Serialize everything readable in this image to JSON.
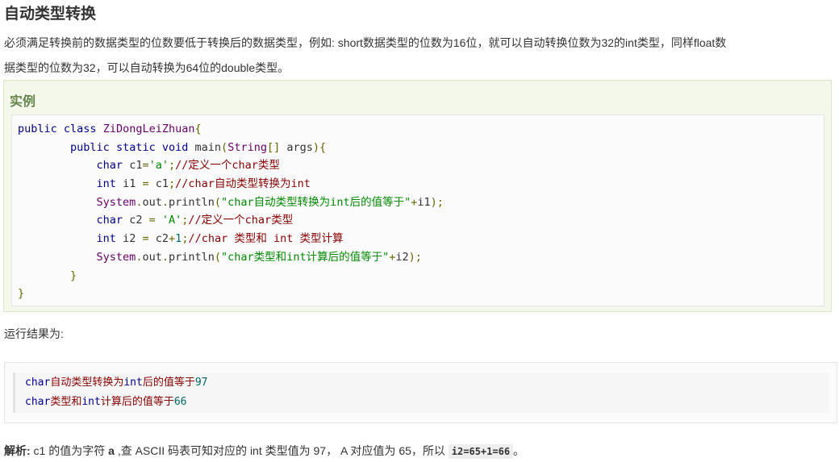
{
  "title": "自动类型转换",
  "paragraph_line1": "必须满足转换前的数据类型的位数要低于转换后的数据类型，例如: short数据类型的位数为16位，就可以自动转换位数为32的int类型，同样float数",
  "paragraph_line2": "据类型的位数为32，可以自动转换为64位的double类型。",
  "example_title": "实例",
  "code": {
    "l1_kw1": "public",
    "l1_kw2": "class",
    "l1_name": "ZiDongLeiZhuan",
    "l1_brace": "{",
    "l2_kw1": "public",
    "l2_kw2": "static",
    "l2_kw3": "void",
    "l2_name": "main",
    "l2_open": "(",
    "l2_type": "String",
    "l2_arr": "[]",
    "l2_arg": "args",
    "l2_close": "){",
    "l3_kw": "char",
    "l3_var": "c1",
    "l3_eq": "=",
    "l3_str": "'a'",
    "l3_semi": ";",
    "l3_comment": "//定义一个char类型",
    "l4_kw": "int",
    "l4_var": "i1",
    "l4_eq": "=",
    "l4_rhs": "c1",
    "l4_semi": ";",
    "l4_comment": "//char自动类型转换为int",
    "l5_sys": "System",
    "l5_dot1": ".",
    "l5_out": "out",
    "l5_dot2": ".",
    "l5_println": "println",
    "l5_open": "(",
    "l5_str": "\"char自动类型转换为int后的值等于\"",
    "l5_plus": "+",
    "l5_var": "i1",
    "l5_close": ");",
    "l6_kw": "char",
    "l6_var": "c2",
    "l6_eq": "=",
    "l6_str": "'A'",
    "l6_semi": ";",
    "l6_comment": "//定义一个char类型",
    "l7_kw": "int",
    "l7_var": "i2",
    "l7_eq": "=",
    "l7_rhs": "c2",
    "l7_plus": "+",
    "l7_lit": "1",
    "l7_semi": ";",
    "l7_comment": "//char 类型和 int 类型计算",
    "l8_sys": "System",
    "l8_dot1": ".",
    "l8_out": "out",
    "l8_dot2": ".",
    "l8_println": "println",
    "l8_open": "(",
    "l8_str": "\"char类型和int计算后的值等于\"",
    "l8_plus": "+",
    "l8_var": "i2",
    "l8_close": ");",
    "l9_brace": "}",
    "l10_brace": "}"
  },
  "run_result_label": "运行结果为:",
  "output": {
    "line1_a": "char",
    "line1_b": "自动类型转换为",
    "line1_c": "int",
    "line1_d": "后的值等于",
    "line1_e": "97",
    "line2_a": "char",
    "line2_b": "类型和",
    "line2_c": "int",
    "line2_d": "计算后的值等于",
    "line2_e": "66"
  },
  "analysis": {
    "label": "解析:",
    "text1": " c1 的值为字符 ",
    "char_a": "a",
    "text2": " ,查 ASCII 码表可知对应的 int 类型值为 97， A 对应值为 65，所以 ",
    "code": "i2=65+1=66",
    "text3": "。"
  }
}
